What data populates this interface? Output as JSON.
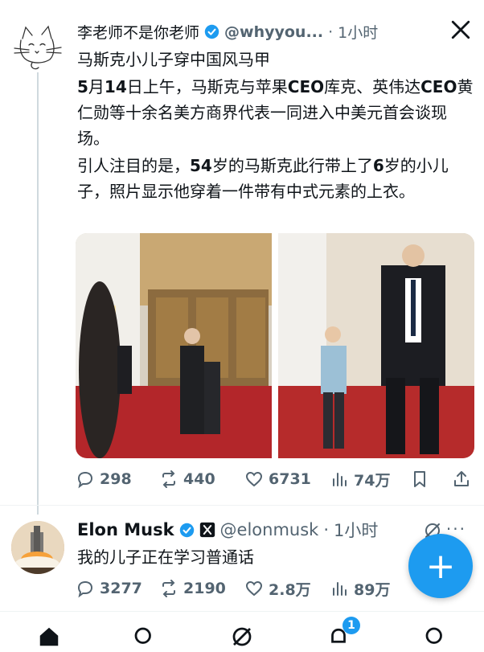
{
  "tweet": {
    "author_name": "李老师不是你老师",
    "handle": "@whyyou...",
    "separator": "·",
    "time": "1小时",
    "title_line": "马斯克小儿子穿中国风马甲",
    "para1": [
      {
        "t": "5",
        "b": true
      },
      {
        "t": "月",
        "b": false
      },
      {
        "t": "14",
        "b": true
      },
      {
        "t": "日上午，马斯克与苹果",
        "b": false
      },
      {
        "t": "CEO",
        "b": true
      },
      {
        "t": "库克、英伟达",
        "b": false
      },
      {
        "t": "CEO",
        "b": true
      },
      {
        "t": "黄仁勋等十余名美方商界代表一同进入中美元首会谈现场。",
        "b": false
      }
    ],
    "para2": [
      {
        "t": "引人注目的是，",
        "b": false
      },
      {
        "t": "54",
        "b": true
      },
      {
        "t": "岁的马斯克此行带上了",
        "b": false
      },
      {
        "t": "6",
        "b": true
      },
      {
        "t": "岁的小儿子，照片显示他穿着一件带有中式元素的上衣。",
        "b": false
      }
    ],
    "stats": {
      "replies": "298",
      "reposts": "440",
      "likes": "6731",
      "views": "74万"
    }
  },
  "reply": {
    "author_name": "Elon Musk",
    "handle": "@elonmusk",
    "separator": "·",
    "time": "1小时",
    "text": "我的儿子正在学习普通话",
    "stats": {
      "replies": "3277",
      "reposts": "2190",
      "likes": "2.8万",
      "views": "89万"
    }
  },
  "nav": {
    "notifications_badge": "1"
  },
  "colors": {
    "accent": "#1d9bf0",
    "muted": "#536471",
    "text": "#0f1419"
  },
  "icons": [
    "verified-badge-icon",
    "x-logo-icon",
    "reply-icon",
    "repost-icon",
    "like-icon",
    "views-icon",
    "bookmark-icon",
    "share-icon",
    "grok-icon",
    "more-icon",
    "compose-icon",
    "home-icon",
    "search-icon",
    "notifications-icon"
  ]
}
